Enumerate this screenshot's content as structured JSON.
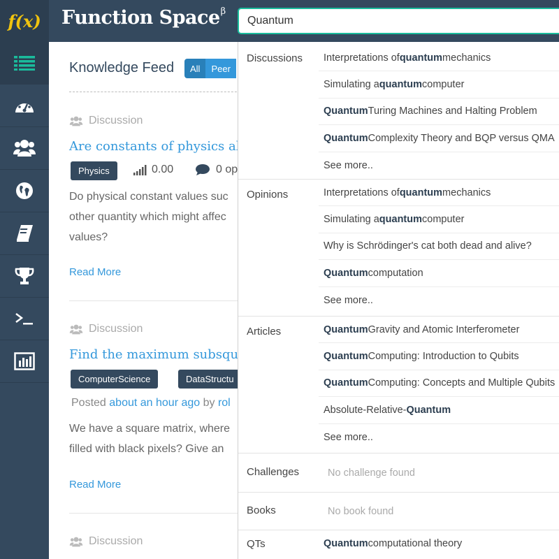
{
  "app": {
    "logo": "f(x)",
    "name": "Function Space",
    "name_sup": "β"
  },
  "search": {
    "value": "Quantum"
  },
  "sidebar": {
    "items": [
      {
        "icon": "list-icon",
        "active": true
      },
      {
        "icon": "dashboard-icon"
      },
      {
        "icon": "users-icon"
      },
      {
        "icon": "globe-icon"
      },
      {
        "icon": "book-icon"
      },
      {
        "icon": "trophy-icon"
      },
      {
        "icon": "terminal-icon"
      },
      {
        "icon": "bar-chart-icon"
      }
    ]
  },
  "feed": {
    "title": "Knowledge Feed",
    "filters": [
      "All",
      "Peer"
    ],
    "posts": [
      {
        "type": "Discussion",
        "title": "Are constants of physics al",
        "tag": "Physics",
        "score": "0.00",
        "opinions": "0 op",
        "excerpt_lines": [
          "Do physical constant values suc",
          "other quantity which might affec",
          "values?"
        ],
        "read_more": "Read More"
      },
      {
        "type": "Discussion",
        "title": "Find the maximum subsqu",
        "tags": [
          "ComputerScience",
          "DataStructu"
        ],
        "posted_prefix": "Posted ",
        "posted_time": "about an hour ago",
        "posted_by": " by ",
        "posted_user": "rol",
        "excerpt_lines": [
          "We have a square matrix, where",
          "filled with black pixels? Give an"
        ],
        "read_more": "Read More"
      },
      {
        "type": "Discussion"
      }
    ]
  },
  "dropdown": {
    "groups": [
      {
        "category": "Discussions",
        "results": [
          {
            "pre": "Interpretations of ",
            "bold": "quantum",
            "post": " mechanics"
          },
          {
            "pre": "Simulating a ",
            "bold": "quantum",
            "post": " computer"
          },
          {
            "pre": "",
            "bold": "Quantum",
            "post": " Turing Machines and Halting Problem"
          },
          {
            "pre": "",
            "bold": "Quantum",
            "post": " Complexity Theory and BQP versus QMA"
          },
          {
            "pre": "See more..",
            "bold": "",
            "post": ""
          }
        ]
      },
      {
        "category": "Opinions",
        "results": [
          {
            "pre": "Interpretations of ",
            "bold": "quantum",
            "post": " mechanics"
          },
          {
            "pre": "Simulating a ",
            "bold": "quantum",
            "post": " computer"
          },
          {
            "pre": "Why is Schrödinger's cat both dead and alive?",
            "bold": "",
            "post": ""
          },
          {
            "pre": "",
            "bold": "Quantum",
            "post": " computation"
          },
          {
            "pre": "See more..",
            "bold": "",
            "post": ""
          }
        ]
      },
      {
        "category": "Articles",
        "results": [
          {
            "pre": "",
            "bold": "Quantum",
            "post": " Gravity and Atomic Interferometer"
          },
          {
            "pre": "",
            "bold": "Quantum",
            "post": " Computing: Introduction to Qubits"
          },
          {
            "pre": "",
            "bold": "Quantum",
            "post": " Computing: Concepts and Multiple Qubits"
          },
          {
            "pre": "Absolute-Relative-",
            "bold": "Quantum",
            "post": ""
          },
          {
            "pre": "See more..",
            "bold": "",
            "post": ""
          }
        ]
      },
      {
        "category": "Challenges",
        "empty": "No challenge found"
      },
      {
        "category": "Books",
        "empty": "No book found"
      },
      {
        "category": "QTs",
        "results": [
          {
            "pre": "",
            "bold": "Quantum",
            "post": " computational theory"
          }
        ]
      }
    ]
  },
  "colors": {
    "sidebar": "#34495e",
    "accent": "#1abc9c",
    "link": "#3498db",
    "logo": "#f1c40f"
  }
}
